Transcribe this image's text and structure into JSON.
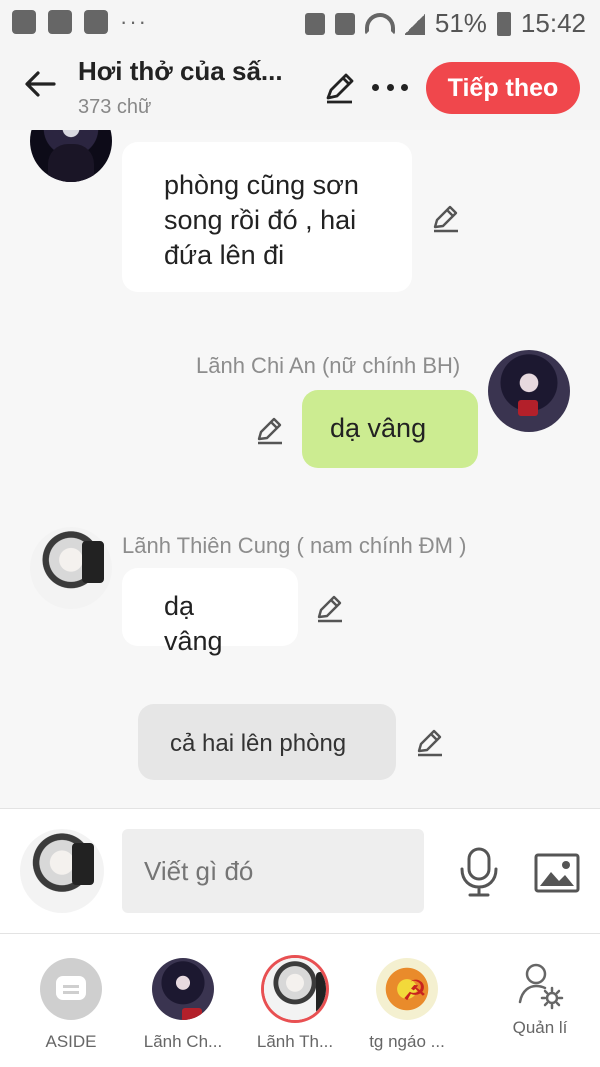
{
  "status_bar": {
    "battery": "51%",
    "time": "15:42",
    "dots": "···"
  },
  "app_bar": {
    "title": "Hơi thở của sấ...",
    "word_count": "373 chữ",
    "next_button": "Tiếp theo"
  },
  "messages": [
    {
      "type": "left",
      "speaker": "",
      "text": "phòng cũng sơn song rồi đó , hai đứa lên đi",
      "avatar": "dark-character-avatar"
    },
    {
      "type": "right",
      "speaker": "Lãnh Chi An (nữ chính BH)",
      "text": "dạ vâng",
      "avatar": "lanh-chi-an-avatar"
    },
    {
      "type": "left",
      "speaker": "Lãnh Thiên Cung ( nam chính ĐM )",
      "text": "dạ vâng",
      "avatar": "lanh-thien-cung-avatar"
    },
    {
      "type": "narration",
      "speaker": "",
      "text": "cả hai lên phòng"
    }
  ],
  "composer": {
    "placeholder": "Viết gì đó"
  },
  "cast": [
    {
      "label": "ASIDE",
      "type": "aside"
    },
    {
      "label": "Lãnh Ch...",
      "type": "girl"
    },
    {
      "label": "Lãnh Th...",
      "type": "boy",
      "selected": true
    },
    {
      "label": "tg ngáo ...",
      "type": "party"
    }
  ],
  "manage": {
    "label": "Quản lí"
  },
  "colors": {
    "accent": "#f0474c",
    "right_bubble": "#ccec91",
    "left_bubble": "#ffffff",
    "narration_bubble": "#e6e6e6"
  }
}
